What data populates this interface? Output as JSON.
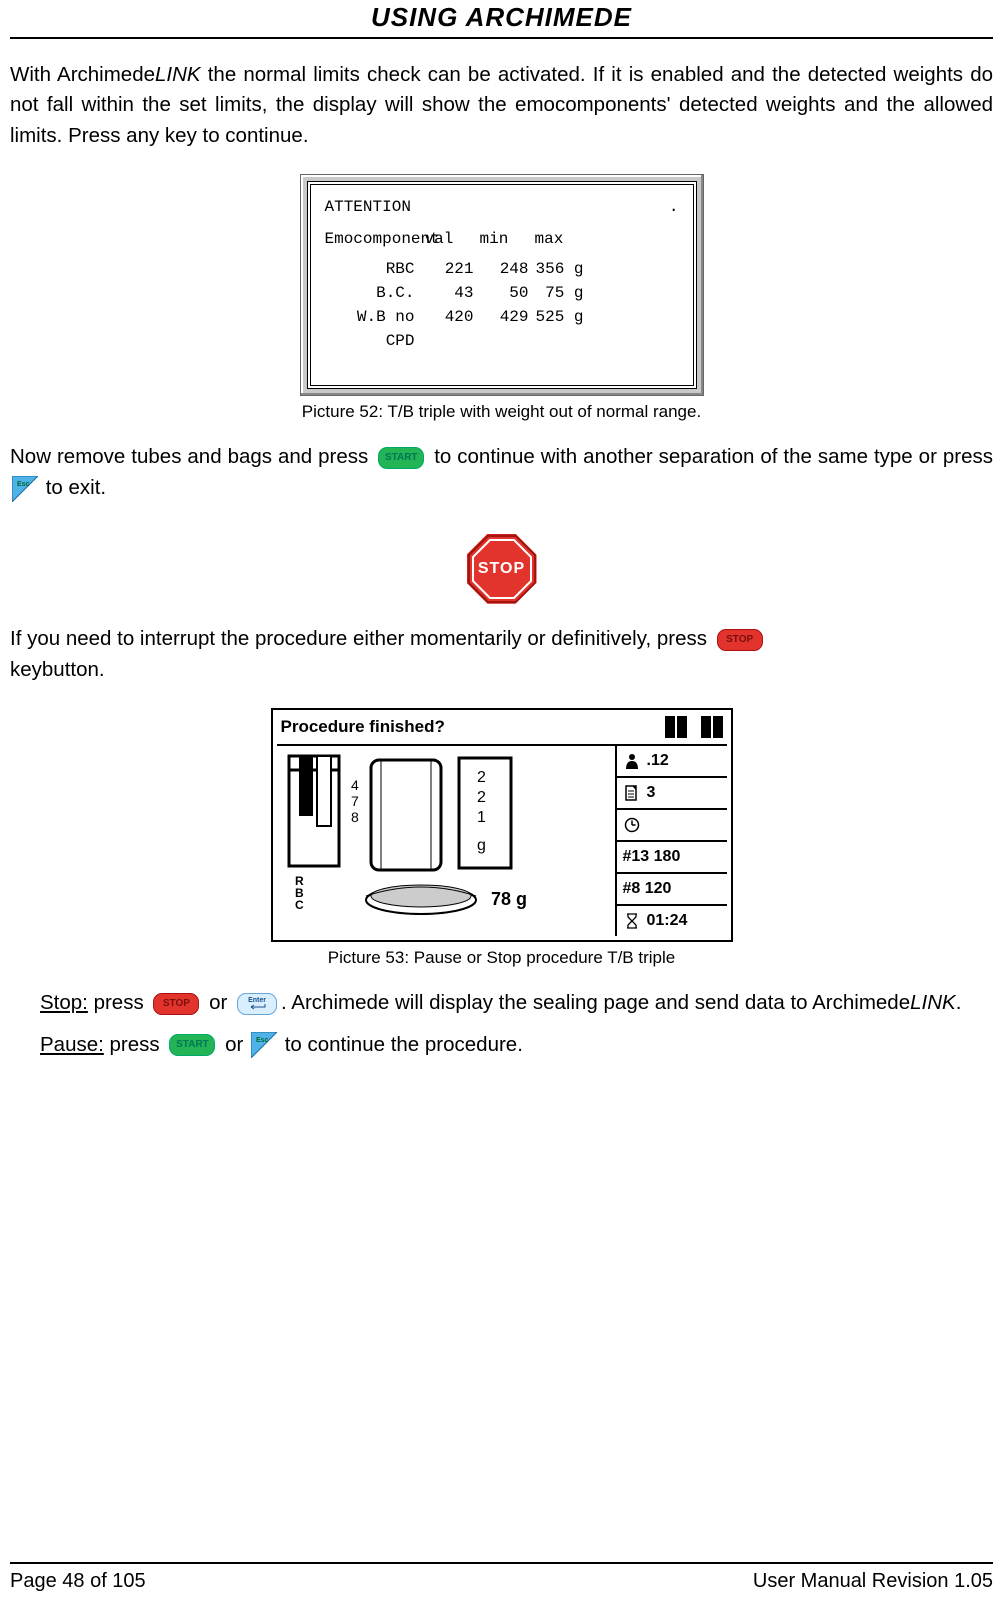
{
  "header": {
    "title": "USING ARCHIMEDE"
  },
  "intro": {
    "t1a": "With Archimede",
    "t1b": "LINK",
    "t1c": " the normal limits check can be activated. If it is enabled and the detected weights do not fall within the set limits, the display will show the emocomponents' detected weights and the allowed limits. Press any key to continue."
  },
  "pic52": {
    "attention": "ATTENTION",
    "dot": ".",
    "hdr": {
      "c0": "Emocomponent",
      "c1": "val",
      "c2": "min",
      "c3": "max"
    },
    "rows": [
      {
        "c0": "RBC",
        "c1": "221",
        "c2": "248",
        "c3": "356 g"
      },
      {
        "c0": "B.C.",
        "c1": "43",
        "c2": "50",
        "c3": "75 g"
      },
      {
        "c0": "W.B no CPD",
        "c1": "420",
        "c2": "429",
        "c3": "525 g"
      }
    ],
    "caption": "Picture 52: T/B triple with weight out of normal range."
  },
  "keys": {
    "start": "START",
    "stop": "STOP",
    "enter": "Enter",
    "esc": "Esc"
  },
  "para2": {
    "a": "Now remove tubes and bags and press ",
    "b": " to continue with another separation of the same type or press ",
    "c": " to exit."
  },
  "stop_sign": {
    "label": "STOP"
  },
  "para3": {
    "a": "If you need to interrupt the procedure either momentarily or definitively, press ",
    "b": "keybutton."
  },
  "pic53": {
    "title": "Procedure finished?",
    "left": {
      "rbc_label": "R B C",
      "digits_v": "4 7 8",
      "digits_box": "2 2 1 g",
      "weight": "78 g"
    },
    "right": {
      "r1": ".12",
      "r2": "3",
      "r3": "",
      "r4": "#13 180",
      "r5": "#8 120",
      "r6": "01:24"
    },
    "caption": "Picture 53: Pause or Stop procedure T/B triple"
  },
  "stop_line": {
    "label": "Stop:",
    "a": " press ",
    "b": " or ",
    "c": ". Archimede will display the sealing page and send data to Archimede",
    "d": "LINK",
    "e": "."
  },
  "pause_line": {
    "label": "Pause:",
    "a": " press ",
    "b": " or ",
    "c": " to continue the procedure."
  },
  "footer": {
    "left": "Page 48 of 105",
    "right": "User Manual Revision 1.05"
  }
}
